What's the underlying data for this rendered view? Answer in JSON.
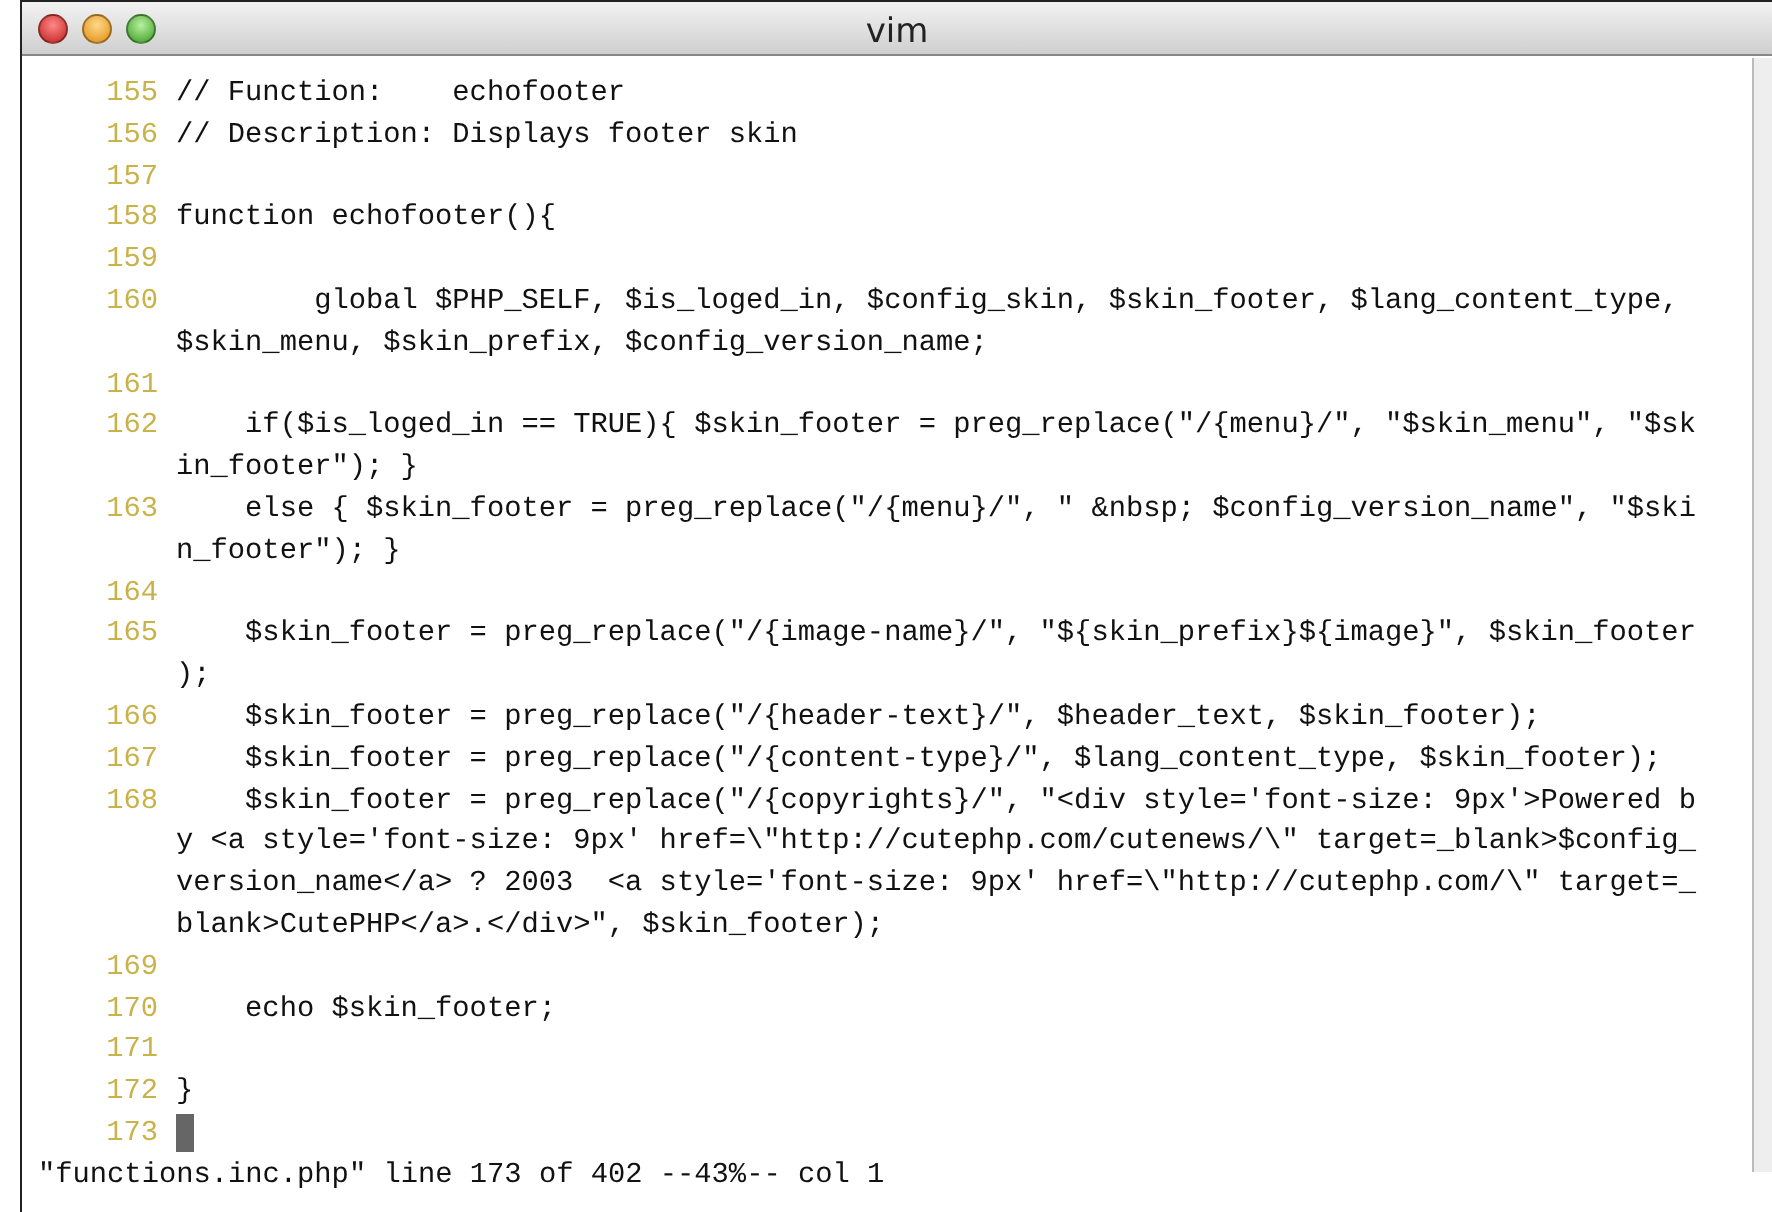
{
  "window": {
    "title": "vim"
  },
  "lines": [
    {
      "number": "155",
      "rows": [
        "// Function:    echofooter"
      ],
      "cursor": false
    },
    {
      "number": "156",
      "rows": [
        "// Description: Displays footer skin"
      ],
      "cursor": false
    },
    {
      "number": "157",
      "cursor": false
    },
    {
      "number": "158",
      "rows": [
        "function echofooter(){"
      ],
      "cursor": false
    },
    {
      "number": "159",
      "cursor": false
    },
    {
      "number": "160",
      "rows": [
        "        global $PHP_SELF, $is_loged_in, $config_skin, $skin_footer, $lang_content_type,",
        "$skin_menu, $skin_prefix, $config_version_name;"
      ],
      "cursor": false
    },
    {
      "number": "161",
      "cursor": false
    },
    {
      "number": "162",
      "rows": [
        "    if($is_loged_in == TRUE){ $skin_footer = preg_replace(\"/{menu}/\", \"$skin_menu\", \"$sk",
        "in_footer\"); }"
      ],
      "cursor": false
    },
    {
      "number": "163",
      "rows": [
        "    else { $skin_footer = preg_replace(\"/{menu}/\", \" &nbsp; $config_version_name\", \"$ski",
        "n_footer\"); }"
      ],
      "cursor": false
    },
    {
      "number": "164",
      "cursor": false
    },
    {
      "number": "165",
      "rows": [
        "    $skin_footer = preg_replace(\"/{image-name}/\", \"${skin_prefix}${image}\", $skin_footer",
        ");"
      ],
      "cursor": false
    },
    {
      "number": "166",
      "rows": [
        "    $skin_footer = preg_replace(\"/{header-text}/\", $header_text, $skin_footer);"
      ],
      "cursor": false
    },
    {
      "number": "167",
      "rows": [
        "    $skin_footer = preg_replace(\"/{content-type}/\", $lang_content_type, $skin_footer);"
      ],
      "cursor": false
    },
    {
      "number": "168",
      "rows": [
        "    $skin_footer = preg_replace(\"/{copyrights}/\", \"<div style='font-size: 9px'>Powered b",
        "y <a style='font-size: 9px' href=\\\"http://cutephp.com/cutenews/\\\" target=_blank>$config_",
        "version_name</a> ? 2003  <a style='font-size: 9px' href=\\\"http://cutephp.com/\\\" target=_",
        "blank>CutePHP</a>.</div>\", $skin_footer);"
      ],
      "cursor": false
    },
    {
      "number": "169",
      "cursor": false
    },
    {
      "number": "170",
      "rows": [
        "    echo $skin_footer;"
      ],
      "cursor": false
    },
    {
      "number": "171",
      "cursor": false
    },
    {
      "number": "172",
      "rows": [
        "}"
      ],
      "cursor": false
    },
    {
      "number": "173",
      "cursor": true
    }
  ],
  "status_line": "\"functions.inc.php\" line 173 of 402 --43%-- col 1"
}
